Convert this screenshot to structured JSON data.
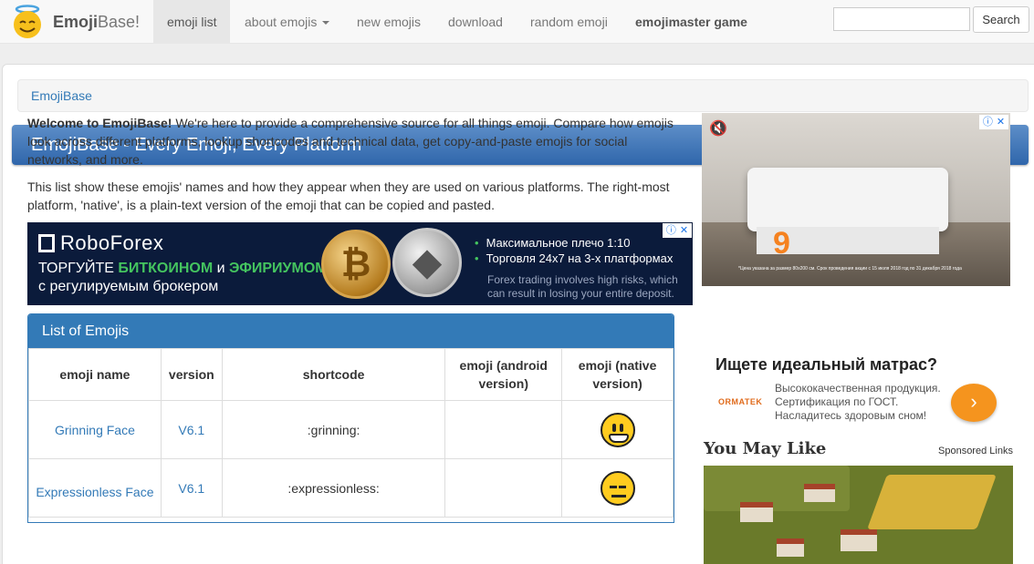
{
  "navbar": {
    "brand_bold": "Emoji",
    "brand_rest": "Base!",
    "items": [
      {
        "label": "emoji list"
      },
      {
        "label": "about emojis"
      },
      {
        "label": "new emojis"
      },
      {
        "label": "download"
      },
      {
        "label": "random emoji"
      },
      {
        "label": "emojimaster game"
      }
    ],
    "search_placeholder": "",
    "search_button": "Search"
  },
  "breadcrumb": "EmojiBase",
  "page_title": "EmojiBase - Every Emoji, Every Platform",
  "intro": {
    "welcome_bold": "Welcome to EmojiBase!",
    "welcome_rest": " We're here to provide a comprehensive source for all things emoji. Compare how emojis look across different platforms, lookup shortcodes and technical data, get copy-and-paste emojis for social networks, and more.",
    "second": "This list show these emojis' names and how they appear when they are used on various platforms. The right-most platform, 'native', is a plain-text version of the emoji that can be copied and pasted."
  },
  "roboforex_ad": {
    "logo": "RoboForex",
    "line1_a": "ТОРГУЙТЕ ",
    "line1_b": "БИТКОИНОМ",
    "line1_c": " и ",
    "line1_d": "ЭФИРИУМОМ",
    "line2": "с регулируемым брокером",
    "bullet1": "Максимальное плечо 1:10",
    "bullet2": "Торговля 24x7 на 3-х платформах",
    "risk": "Forex trading involves high risks, which can result in losing your entire deposit."
  },
  "emoji_panel": {
    "title": "List of Emojis",
    "columns": [
      "emoji name",
      "version",
      "shortcode",
      "emoji (android version)",
      "emoji (native version)"
    ],
    "rows": [
      {
        "name": "Grinning Face",
        "version": "V6.1",
        "shortcode": ":grinning:",
        "android": "",
        "native_icon": "grinning-face-icon"
      },
      {
        "name": "Expressionless Face",
        "version": "V6.1",
        "shortcode": ":expressionless:",
        "android": "",
        "native_icon": "expressionless-face-icon"
      }
    ]
  },
  "side_ad": {
    "digit": "9",
    "fineprint": "*Цена указана за размер 80x200 см. Срок проведения акции с 15 июля 2018 год по 31 декабря 2018 года",
    "title": "Ищете идеальный матрас?",
    "brand": "ORMATEK",
    "text1": "Высококачественная продукция.",
    "text2": "Сертификация по ГОСТ.",
    "text3": "Насладитесь здоровым сном!"
  },
  "may_like": {
    "title": "You May Like",
    "sponsored": "Sponsored Links"
  },
  "colors": {
    "accent": "#337ab7",
    "title_gradient_top": "#5d8ec8",
    "title_gradient_bottom": "#2f66ab",
    "ad_orange": "#f5941e"
  }
}
